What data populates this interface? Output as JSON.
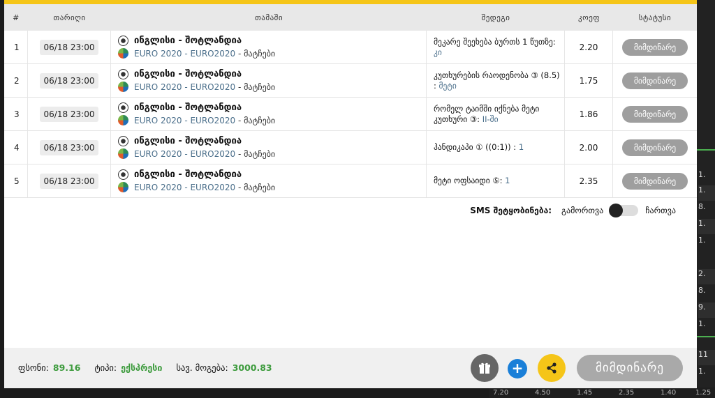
{
  "table": {
    "headers": [
      "#",
      "თარიღი",
      "თამაში",
      "შედეგი",
      "კოეფ",
      "სტატუსი"
    ],
    "rows": [
      {
        "num": "1",
        "date": "06/18 23:00",
        "match": "ინგლისი - შოტლანდია",
        "league": "EURO 2020 - EURO2020",
        "sub_suffix": "- მატჩები",
        "bet": "მეკარე შეეხება ბურთს 1 წუთზე: ",
        "pick": "კი",
        "odd": "2.20",
        "status": "მიმდინარე"
      },
      {
        "num": "2",
        "date": "06/18 23:00",
        "match": "ინგლისი - შოტლანდია",
        "league": "EURO 2020 - EURO2020",
        "sub_suffix": "- მატჩები",
        "bet": "კუთხურების რაოდენობა ③ (8.5) : ",
        "pick": "მეტი",
        "odd": "1.75",
        "status": "მიმდინარე"
      },
      {
        "num": "3",
        "date": "06/18 23:00",
        "match": "ინგლისი - შოტლანდია",
        "league": "EURO 2020 - EURO2020",
        "sub_suffix": "- მატჩები",
        "bet": "რომელ ტაიმში იქნება მეტი კუთხური ③: ",
        "pick": "II-ში",
        "odd": "1.86",
        "status": "მიმდინარე"
      },
      {
        "num": "4",
        "date": "06/18 23:00",
        "match": "ინგლისი - შოტლანდია",
        "league": "EURO 2020 - EURO2020",
        "sub_suffix": "- მატჩები",
        "bet": "ჰანდიკაპი ① ((0:1)) : ",
        "pick": "1",
        "odd": "2.00",
        "status": "მიმდინარე"
      },
      {
        "num": "5",
        "date": "06/18 23:00",
        "match": "ინგლისი - შოტლანდია",
        "league": "EURO 2020 - EURO2020",
        "sub_suffix": "- მატჩები",
        "bet": "მეტი ოფსაიდი ⑤: ",
        "pick": "1",
        "odd": "2.35",
        "status": "მიმდინარე"
      }
    ]
  },
  "sms": {
    "label": "SMS შეტყობინება:",
    "off": "გამორთვა",
    "on": "ჩართვა"
  },
  "footer": {
    "stake_label": "ფსონი:",
    "stake_value": "89.16",
    "type_label": "ტიპი:",
    "type_value": "ექსპრესი",
    "win_label": "სავ. მოგება:",
    "win_value": "3000.83",
    "status_button": "მიმდინარე"
  },
  "background": {
    "side_values": [
      "1.",
      "1.",
      "8.",
      "1.",
      "1.",
      "2.",
      "8.",
      "9.",
      "1.",
      "11",
      "1."
    ],
    "bottom_values": [
      "7.20",
      "4.50",
      "1.45",
      "2.35",
      "1.40",
      "1.25"
    ]
  },
  "colors": {
    "accent": "#f5c518",
    "pick": "#4a6e8a",
    "green": "#3d9b3d",
    "status_grey": "#9e9e9e",
    "plus_blue": "#1a7fd8"
  }
}
